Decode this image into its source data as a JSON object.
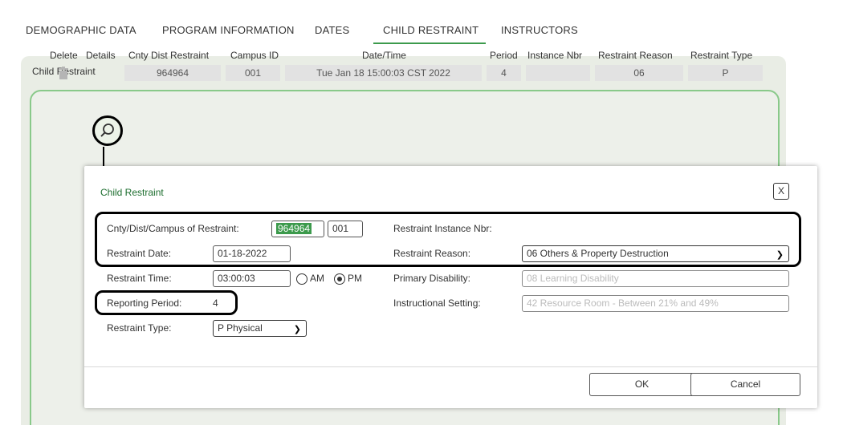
{
  "tabs": [
    {
      "label": "DEMOGRAPHIC DATA"
    },
    {
      "label": "PROGRAM INFORMATION"
    },
    {
      "label": "DATES"
    },
    {
      "label": "CHILD RESTRAINT"
    },
    {
      "label": "INSTRUCTORS"
    }
  ],
  "active_tab": "CHILD RESTRAINT",
  "panel": {
    "title": "Child Restraint",
    "columns": [
      "Delete",
      "Details",
      "Cnty Dist Restraint",
      "Campus ID",
      "Date/Time",
      "Period",
      "Instance Nbr",
      "Restraint Reason",
      "Restraint Type"
    ],
    "row": {
      "cnty_dist_restraint": "964964",
      "campus_id": "001",
      "date_time": "Tue Jan 18 15:00:03 CST 2022",
      "period": "4",
      "instance_nbr": "",
      "restraint_reason": "06",
      "restraint_type": "P"
    }
  },
  "modal": {
    "title": "Child Restraint",
    "close_label": "X",
    "fields": {
      "cnty_dist_campus_label": "Cnty/Dist/Campus of Restraint:",
      "cnty_dist_value": "964964",
      "campus_value": "001",
      "restraint_date_label": "Restraint Date:",
      "restraint_date_value": "01-18-2022",
      "restraint_time_label": "Restraint Time:",
      "restraint_time_value": "03:00:03",
      "am_label": "AM",
      "pm_label": "PM",
      "reporting_period_label": "Reporting Period:",
      "reporting_period_value": "4",
      "restraint_type_label": "Restraint Type:",
      "restraint_type_value": "P Physical",
      "instance_nbr_label": "Restraint Instance Nbr:",
      "restraint_reason_label": "Restraint Reason:",
      "restraint_reason_value": "06 Others & Property Destruction",
      "primary_disability_label": "Primary Disability:",
      "primary_disability_value": "08    Learning Disability",
      "instructional_setting_label": "Instructional Setting:",
      "instructional_setting_value": "42    Resource Room - Between 21% and 49%"
    },
    "ok_label": "OK",
    "cancel_label": "Cancel"
  },
  "colors": {
    "accent": "#3c9a4c",
    "panel_bg": "#e9ede5",
    "modal_title": "#1d6e2f"
  }
}
